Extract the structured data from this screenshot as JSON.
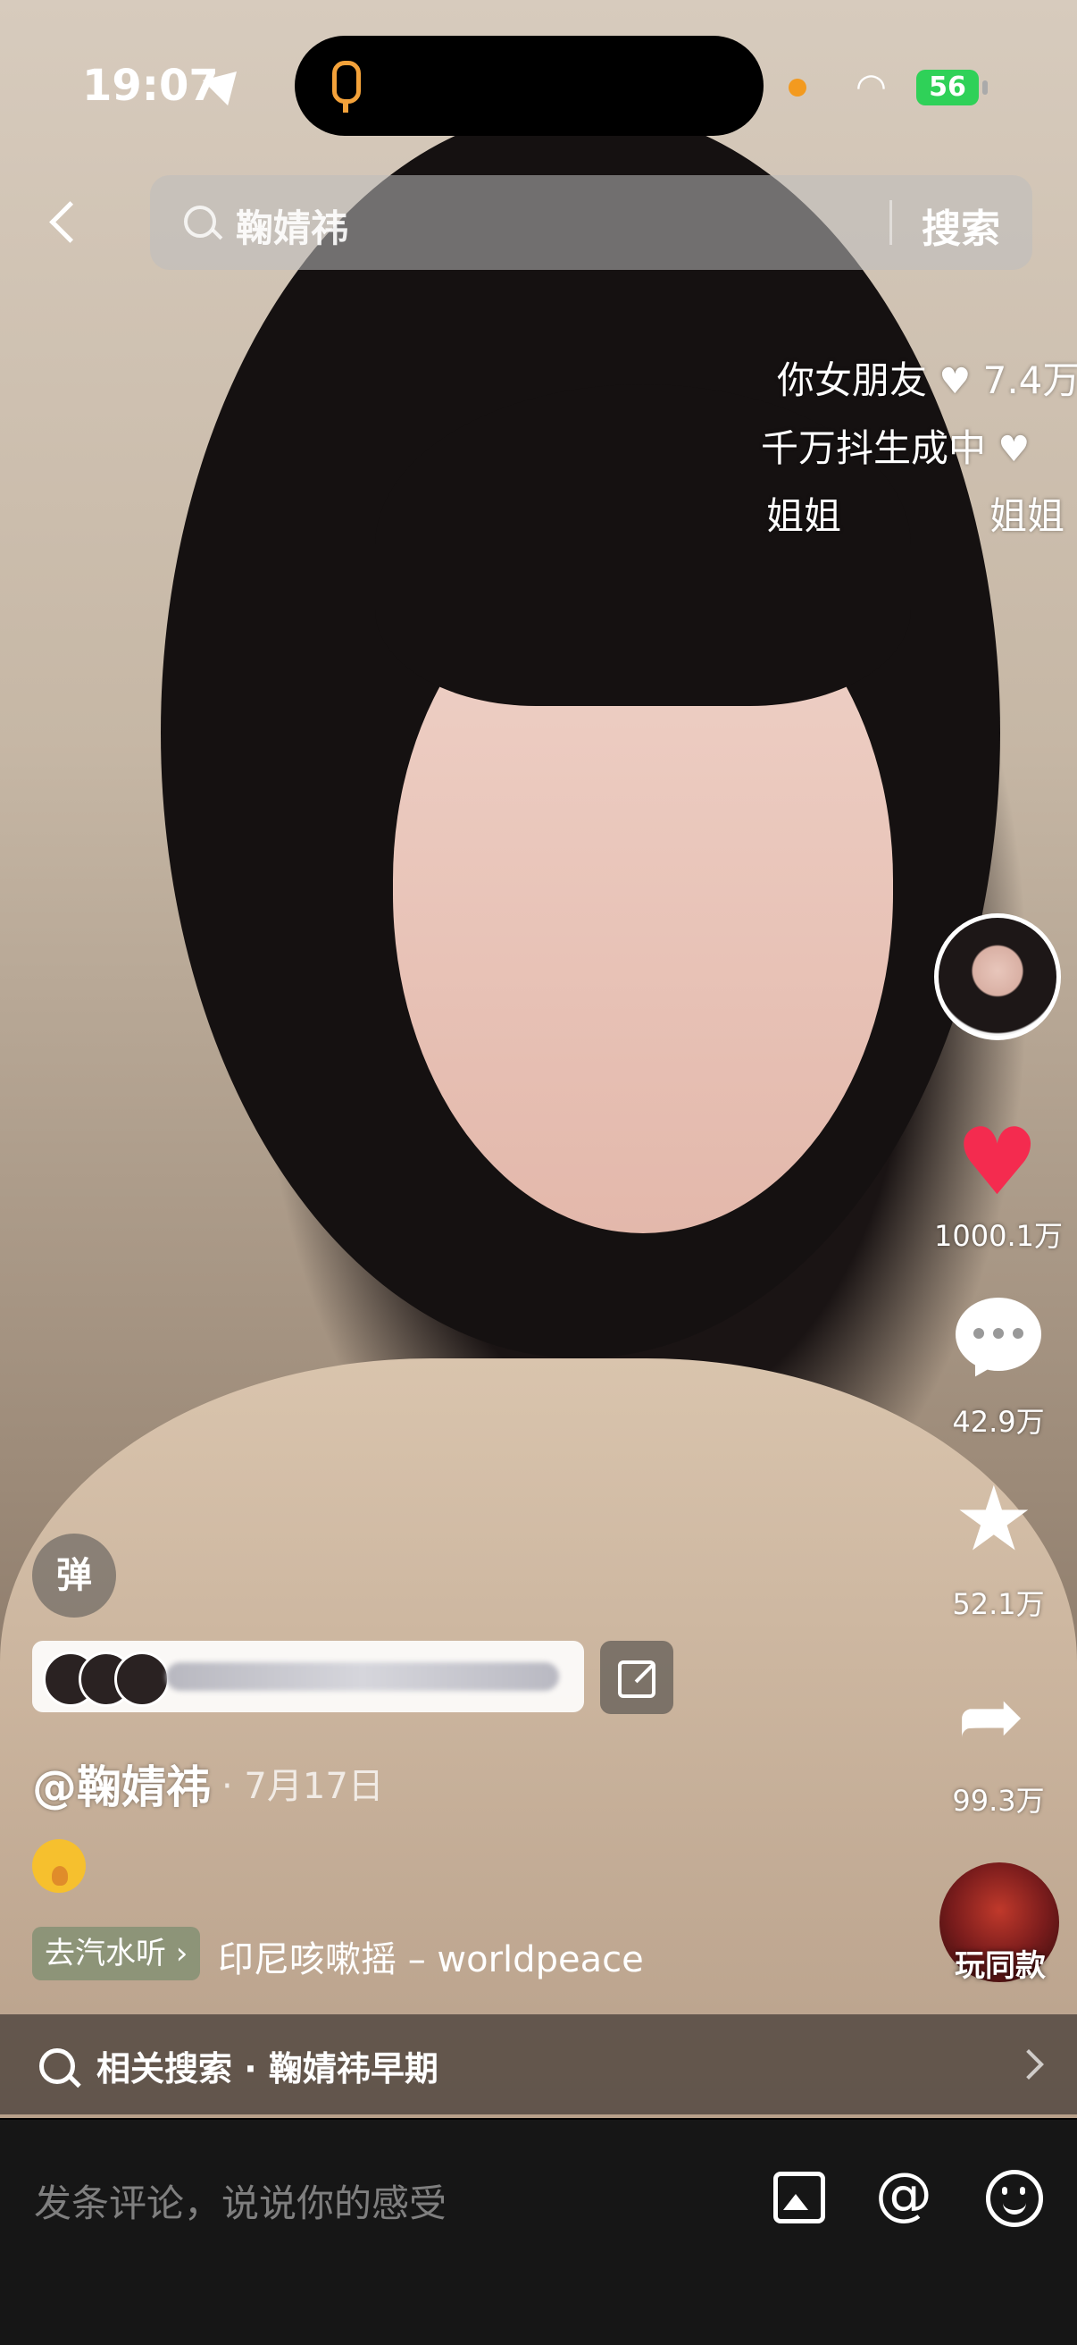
{
  "status_bar": {
    "time": "19:07",
    "battery": "56"
  },
  "search": {
    "query": "鞠婧祎",
    "button_label": "搜索"
  },
  "danmaku": [
    {
      "text": "你女朋友",
      "likes": "7.4万"
    },
    {
      "text": "千万抖生成中",
      "likes": ""
    },
    {
      "text": "姐姐",
      "likes": ""
    },
    {
      "text": "姐姐",
      "likes": ""
    }
  ],
  "rail": {
    "likes": "1000.1万",
    "comments": "42.9万",
    "favorites": "52.1万",
    "shares": "99.3万",
    "play_same_label": "玩同款"
  },
  "danmu_toggle_label": "弹",
  "post": {
    "author": "@鞠婧祎",
    "date": "· 7月17日",
    "music_chip": "去汽水听 ›",
    "music_title": "印尼咳嗽摇 – worldpeace"
  },
  "related": {
    "label": "相关搜索 · 鞠婧祎早期"
  },
  "comment_input": {
    "placeholder": "发条评论，说说你的感受"
  }
}
